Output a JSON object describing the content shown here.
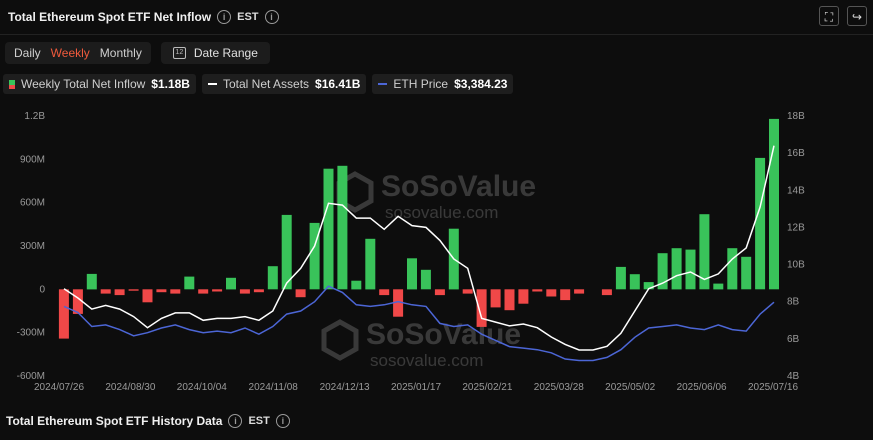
{
  "header": {
    "title": "Total Ethereum Spot ETF Net Inflow",
    "timezone": "EST"
  },
  "controls": {
    "periods": [
      "Daily",
      "Weekly",
      "Monthly"
    ],
    "active_period": "Weekly",
    "date_range_label": "Date Range"
  },
  "legend": [
    {
      "label": "Weekly Total Net Inflow",
      "value": "$1.18B"
    },
    {
      "label": "Total Net Assets",
      "value": "$16.41B"
    },
    {
      "label": "ETH Price",
      "value": "$3,384.23"
    }
  ],
  "footer": {
    "title": "Total Ethereum Spot ETF History Data",
    "timezone": "EST"
  },
  "watermark": {
    "brand": "SoSoValue",
    "domain": "sosovalue.com"
  },
  "colors": {
    "positive": "#39c35a",
    "negative": "#f04848",
    "net_assets_line": "#ffffff",
    "eth_price_line": "#4c66d6",
    "accent": "#f05a3c"
  },
  "chart_data": {
    "type": "bar",
    "x_tick_labels": [
      "2024/07/26",
      "2024/08/30",
      "2024/10/04",
      "2024/11/08",
      "2024/12/13",
      "2025/01/17",
      "2025/02/21",
      "2025/03/28",
      "2025/05/02",
      "2025/06/06",
      "2025/07/16"
    ],
    "left_axis": {
      "ticks": [
        "1.2B",
        "900M",
        "600M",
        "300M",
        "0",
        "-300M",
        "-600M"
      ],
      "range": [
        -600,
        1200
      ],
      "unit": "M"
    },
    "right_axis": {
      "ticks": [
        "18B",
        "16B",
        "14B",
        "12B",
        "10B",
        "8B",
        "6B",
        "4B"
      ],
      "range": [
        4,
        18
      ],
      "unit": "B"
    },
    "series": [
      {
        "name": "Weekly Total Net Inflow",
        "kind": "bar",
        "axis": "left",
        "values": [
          -341,
          -170,
          107,
          -30,
          -40,
          -10,
          -90,
          -20,
          -30,
          88,
          -30,
          -15,
          80,
          -30,
          -20,
          160,
          515,
          -55,
          460,
          835,
          855,
          60,
          350,
          -40,
          -190,
          215,
          135,
          -40,
          420,
          -30,
          -260,
          -125,
          -145,
          -100,
          -15,
          -50,
          -75,
          -30,
          0,
          -40,
          155,
          105,
          50,
          250,
          285,
          275,
          520,
          40,
          285,
          225,
          910,
          1180
        ]
      },
      {
        "name": "Total Net Assets",
        "kind": "line",
        "axis": "right",
        "values": [
          8.7,
          8.2,
          7.6,
          7.8,
          7.6,
          7.2,
          6.6,
          7.1,
          7.4,
          7.4,
          7.0,
          7.1,
          7.1,
          7.2,
          7.0,
          7.5,
          9.0,
          9.8,
          11.0,
          13.3,
          13.2,
          12.5,
          12.5,
          11.9,
          12.6,
          12.1,
          12.0,
          11.3,
          10.3,
          9.8,
          7.1,
          6.9,
          6.7,
          6.8,
          6.6,
          6.1,
          5.7,
          5.4,
          5.4,
          5.6,
          6.3,
          7.5,
          8.7,
          9.0,
          9.4,
          9.6,
          9.2,
          9.5,
          10.3,
          10.9,
          13.1,
          16.4
        ]
      },
      {
        "name": "ETH Price",
        "kind": "line",
        "axis": "right",
        "values": [
          3250,
          3050,
          2600,
          2650,
          2500,
          2300,
          2400,
          2550,
          2650,
          2500,
          2400,
          2450,
          2400,
          2550,
          2350,
          2600,
          3000,
          3100,
          3400,
          3900,
          3700,
          3300,
          3250,
          3300,
          3400,
          3300,
          3250,
          2700,
          2600,
          2650,
          2350,
          2150,
          1950,
          1900,
          1850,
          1750,
          1550,
          1500,
          1500,
          1600,
          1850,
          2250,
          2550,
          2600,
          2650,
          2550,
          2500,
          2650,
          2500,
          2450,
          3000,
          3384.23
        ]
      }
    ],
    "grid": false
  }
}
